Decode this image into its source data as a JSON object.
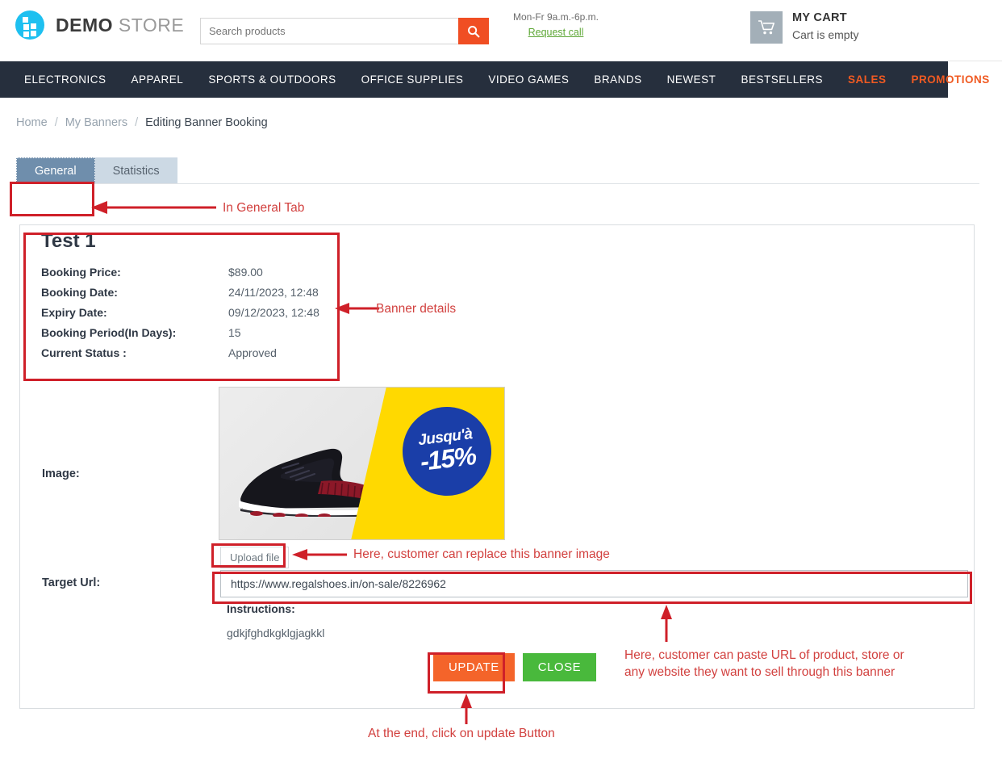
{
  "header": {
    "logo": {
      "icon": "grid-squares-logo-icon",
      "bold": "DEMO",
      "light": " STORE"
    },
    "search": {
      "placeholder": "Search products",
      "value": "",
      "button_icon": "search-icon"
    },
    "hours": "Mon-Fr 9a.m.-6p.m.",
    "request_call": "Request call",
    "cart": {
      "icon": "shopping-cart-icon",
      "title": "MY CART",
      "status": "Cart is empty"
    }
  },
  "nav": {
    "items": [
      {
        "label": "ELECTRONICS",
        "accent": false
      },
      {
        "label": "APPAREL",
        "accent": false
      },
      {
        "label": "SPORTS & OUTDOORS",
        "accent": false
      },
      {
        "label": "OFFICE SUPPLIES",
        "accent": false
      },
      {
        "label": "VIDEO GAMES",
        "accent": false
      },
      {
        "label": "BRANDS",
        "accent": false
      },
      {
        "label": "NEWEST",
        "accent": false
      },
      {
        "label": "BESTSELLERS",
        "accent": false
      },
      {
        "label": "SALES",
        "accent": true
      },
      {
        "label": "PROMOTIONS",
        "accent": true
      }
    ]
  },
  "breadcrumb": {
    "home": "Home",
    "sep": "/",
    "parent": "My Banners",
    "current": "Editing Banner Booking"
  },
  "tabs": [
    {
      "label": "General",
      "active": true
    },
    {
      "label": "Statistics",
      "active": false
    }
  ],
  "banner": {
    "title": "Test 1",
    "details": [
      {
        "label": "Booking Price:",
        "value": "$89.00"
      },
      {
        "label": "Booking Date:",
        "value": "24/11/2023, 12:48"
      },
      {
        "label": "Expiry Date:",
        "value": "09/12/2023, 12:48"
      },
      {
        "label": "Booking Period(In Days):",
        "value": "15"
      },
      {
        "label": "Current Status :",
        "value": "Approved"
      }
    ],
    "image_label": "Image:",
    "image_alt": {
      "badge_line1": "Jusqu'à",
      "badge_line2": "-15%"
    },
    "upload_label": "Upload file",
    "url_label": "Target Url:",
    "url_value": "https://www.regalshoes.in/on-sale/8226962",
    "url_placeholder": "https://",
    "instructions_label": "Instructions:",
    "instructions_text": "gdkjfghdkgklgjagkkl",
    "update_label": "UPDATE",
    "close_label": "CLOSE"
  },
  "annotations": [
    {
      "id": "tab",
      "text": "In General Tab"
    },
    {
      "id": "details",
      "text": "Banner details"
    },
    {
      "id": "upload",
      "text": "Here, customer can replace this banner image"
    },
    {
      "id": "url",
      "text": "Here, customer can paste URL of product, store or\nany website they want to sell through this banner"
    },
    {
      "id": "update",
      "text": "At the end, click on update Button"
    }
  ],
  "colors": {
    "accent_orange": "#f04e23",
    "nav_dark": "#262f3d",
    "tab_active": "#6f8eac",
    "tab_idle": "#ccd9e4",
    "annotation_red": "#cf2029",
    "update_button": "#f4642a",
    "close_button": "#49b93c",
    "logo_cyan": "#1ec0f0",
    "link_green": "#5fa838"
  }
}
